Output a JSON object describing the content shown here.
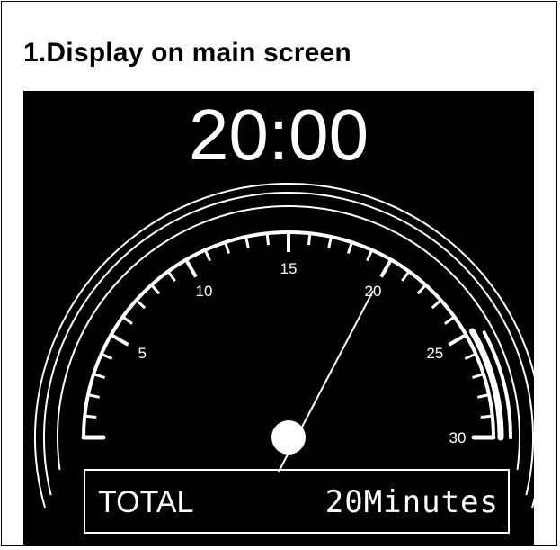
{
  "section_title": "1.Display on main screen",
  "display": {
    "time": "20:00",
    "total_label": "TOTAL",
    "total_value": "20Minutes"
  },
  "gauge": {
    "min": 0,
    "max": 30,
    "labeled_ticks": [
      5,
      10,
      15,
      20,
      25,
      30
    ],
    "needle_value": 20,
    "highlight_range": [
      25,
      30
    ],
    "colors": {
      "background": "#000000",
      "foreground": "#ffffff"
    }
  }
}
